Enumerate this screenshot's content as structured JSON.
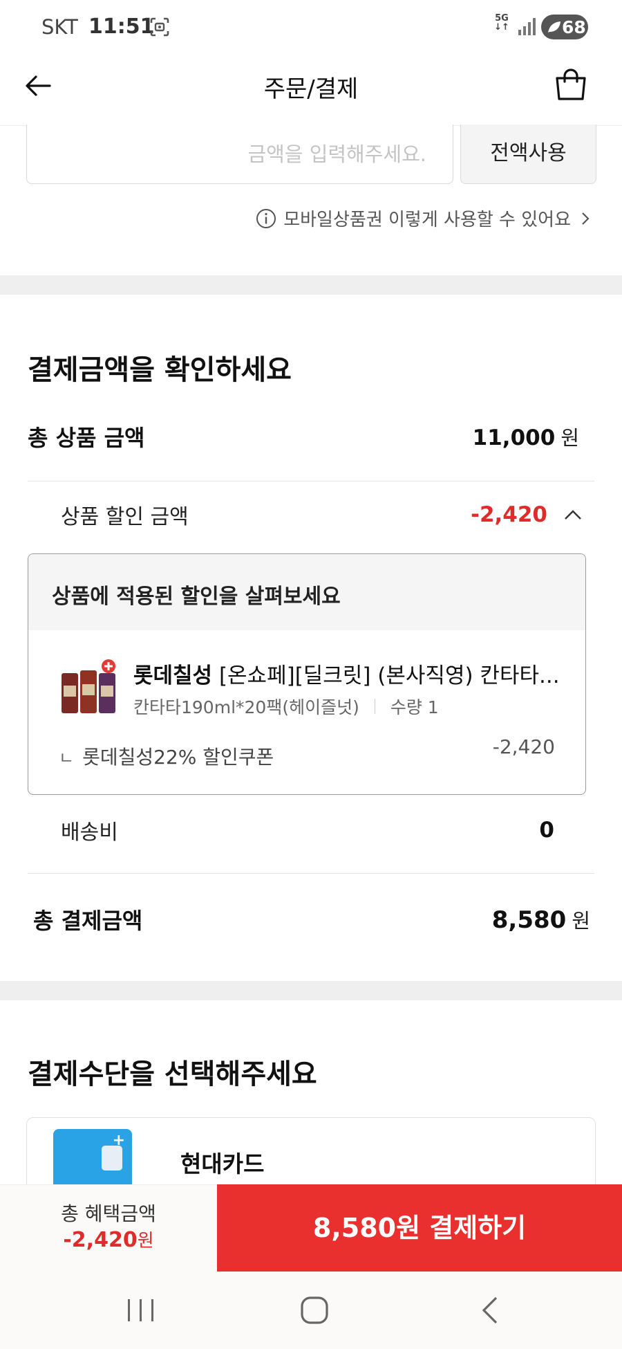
{
  "status_bar": {
    "carrier": "SKT",
    "time": "11:51",
    "network": "5G",
    "battery": "68",
    "icons": [
      "screen-capture-icon",
      "signal-icon",
      "battery-icon"
    ]
  },
  "header": {
    "title": "주문/결제",
    "icons": [
      "back-arrow-icon",
      "shopping-bag-icon"
    ]
  },
  "giftcard": {
    "amount_placeholder": "금액을 입력해주세요.",
    "use_all_label": "전액사용",
    "help_text": "모바일상품권 이렇게 사용할 수 있어요"
  },
  "summary": {
    "title": "결제금액을 확인하세요",
    "total_product_label": "총 상품 금액",
    "total_product_value": "11,000",
    "currency": "원",
    "discount_label": "상품 할인 금액",
    "discount_value": "-2,420",
    "discount_box": {
      "title": "상품에 적용된 할인을 살펴보세요",
      "product_brand": "롯데칠성",
      "product_name": " [온쇼페][딜크릿] (본사직영) 칸타타...",
      "product_option": "칸타타190ml*20팩(헤이즐넛)",
      "quantity": "수량 1",
      "coupon_mark": "ㄴ",
      "coupon_label": "롯데칠성22% 할인쿠폰",
      "coupon_value": "-2,420"
    },
    "shipping_label": "배송비",
    "shipping_value": "0",
    "total_pay_label": "총 결제금액",
    "total_pay_value": "8,580"
  },
  "payment_method": {
    "title": "결제수단을 선택해주세요",
    "card_name": "현대카드"
  },
  "bottom_bar": {
    "benefit_label": "총 혜택금액",
    "benefit_value": "-2,420",
    "benefit_currency": "원",
    "pay_button": "8,580원 결제하기"
  },
  "colors": {
    "accent_red": "#e9302f",
    "discount_red": "#e02b2b",
    "card_blue": "#2aa3e6"
  }
}
